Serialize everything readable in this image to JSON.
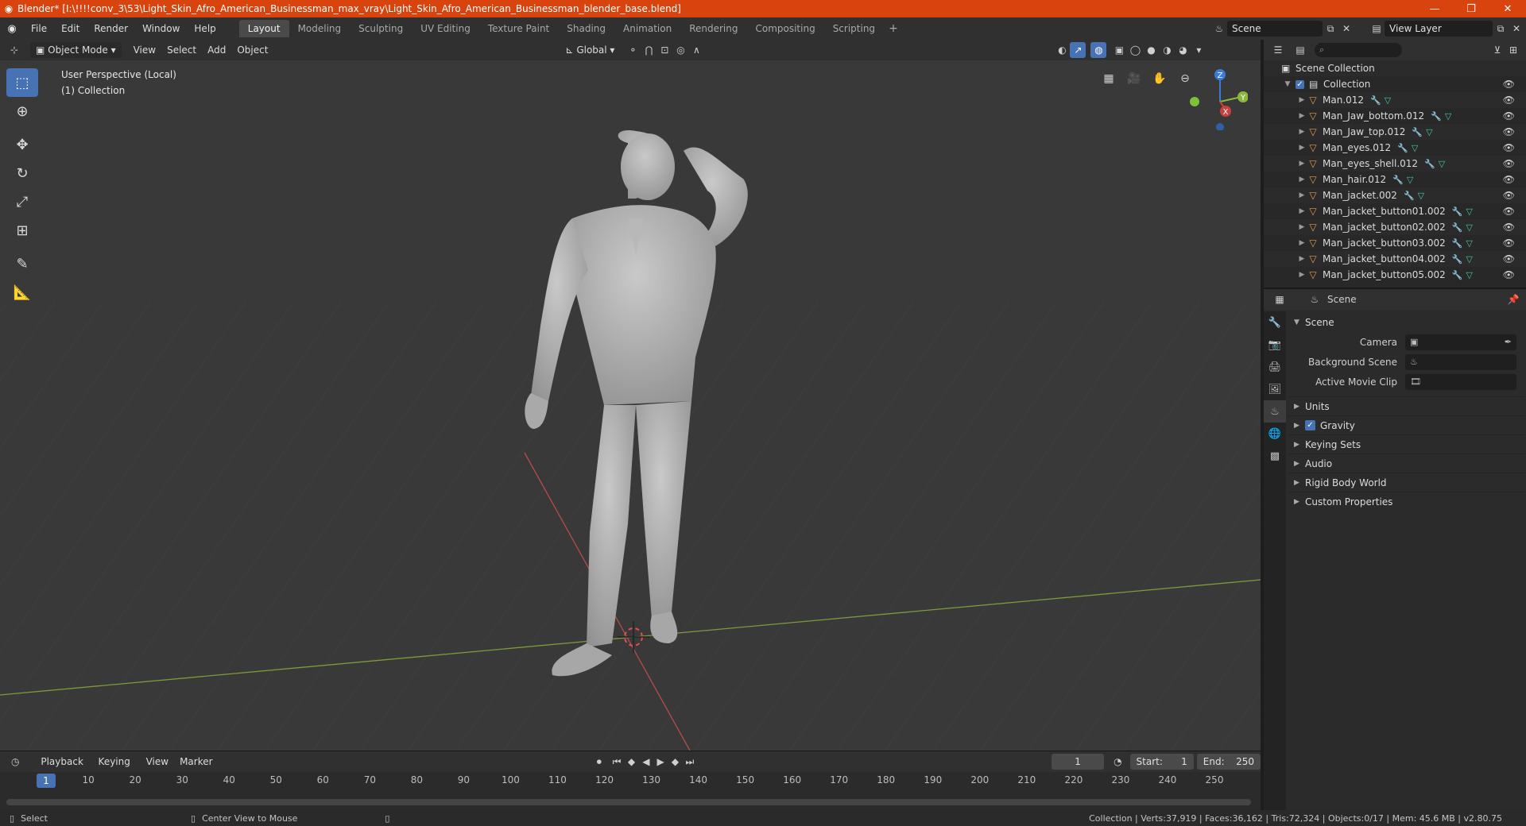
{
  "window": {
    "title": "Blender* [I:\\!!!!conv_3\\53\\Light_Skin_Afro_American_Businessman_max_vray\\Light_Skin_Afro_American_Businessman_blender_base.blend]",
    "minimize": "—",
    "restore": "❐",
    "close": "✕"
  },
  "menubar": {
    "items": [
      "File",
      "Edit",
      "Render",
      "Window",
      "Help"
    ],
    "workspaces": [
      "Layout",
      "Modeling",
      "Sculpting",
      "UV Editing",
      "Texture Paint",
      "Shading",
      "Animation",
      "Rendering",
      "Compositing",
      "Scripting"
    ],
    "active_workspace": "Layout",
    "add": "+",
    "scene": "Scene",
    "view_layer": "View Layer"
  },
  "viewport": {
    "mode": "Object Mode",
    "menus": [
      "View",
      "Select",
      "Add",
      "Object"
    ],
    "orientation": "Global",
    "overlay_line1": "User Perspective (Local)",
    "overlay_line2": "(1) Collection",
    "gizmo": {
      "z": "Z",
      "y": "Y",
      "x": "X"
    }
  },
  "timeline": {
    "menus": [
      "Playback",
      "Keying",
      "View",
      "Marker"
    ],
    "current_frame": "1",
    "start_label": "Start:",
    "start": "1",
    "end_label": "End:",
    "end": "250",
    "ticks": [
      "1",
      "10",
      "20",
      "30",
      "40",
      "50",
      "60",
      "70",
      "80",
      "90",
      "100",
      "110",
      "120",
      "130",
      "140",
      "150",
      "160",
      "170",
      "180",
      "190",
      "200",
      "210",
      "220",
      "230",
      "240",
      "250"
    ]
  },
  "statusbar": {
    "select": "Select",
    "center_view": "Center View to Mouse",
    "stats": "Collection | Verts:37,919 | Faces:36,162 | Tris:72,324 | Objects:0/17 | Mem: 45.6 MB | v2.80.75"
  },
  "outliner": {
    "root": "Scene Collection",
    "collection": "Collection",
    "objects": [
      "Man.012",
      "Man_Jaw_bottom.012",
      "Man_Jaw_top.012",
      "Man_eyes.012",
      "Man_eyes_shell.012",
      "Man_hair.012",
      "Man_jacket.002",
      "Man_jacket_button01.002",
      "Man_jacket_button02.002",
      "Man_jacket_button03.002",
      "Man_jacket_button04.002",
      "Man_jacket_button05.002"
    ]
  },
  "properties": {
    "context": "Scene",
    "panel_title": "Scene",
    "camera_label": "Camera",
    "background_scene_label": "Background Scene",
    "active_movie_clip_label": "Active Movie Clip",
    "subpanels": [
      "Units",
      "Gravity",
      "Keying Sets",
      "Audio",
      "Rigid Body World",
      "Custom Properties"
    ]
  },
  "colors": {
    "accent": "#4772b3",
    "titlebar": "#d8430e",
    "axis_x": "#c8413f",
    "axis_y": "#8ab83e",
    "axis_z": "#3b7ad8"
  }
}
